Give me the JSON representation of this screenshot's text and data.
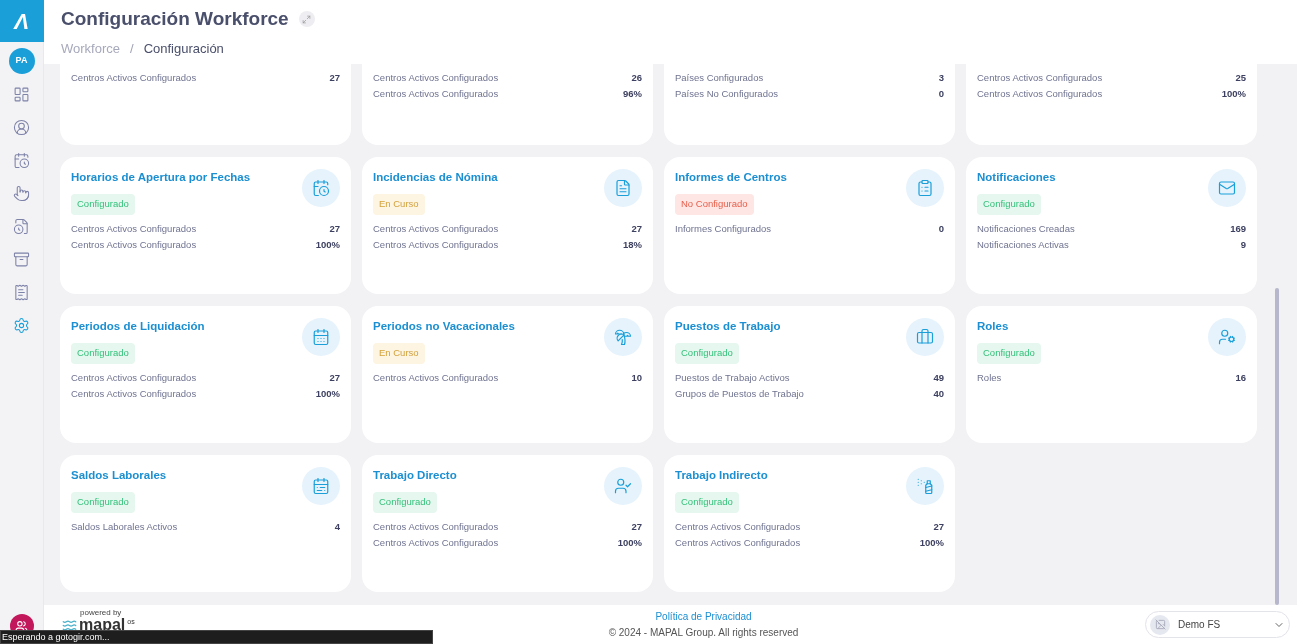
{
  "sidebar": {
    "logo": "Λ",
    "avatar": "PA",
    "items": [
      {
        "selected": false
      },
      {
        "selected": false
      },
      {
        "selected": false
      },
      {
        "selected": false
      },
      {
        "selected": false
      },
      {
        "selected": false
      },
      {
        "selected": false
      },
      {
        "selected": true
      }
    ]
  },
  "header": {
    "title": "Configuración Workforce",
    "breadcrumb": [
      {
        "label": "Workforce",
        "current": false
      },
      {
        "label": "Configuración",
        "current": true
      }
    ],
    "separator": "/"
  },
  "cards": [
    {
      "stats": [
        {
          "label": "Centros Activos Configurados",
          "value": "27"
        }
      ]
    },
    {
      "stats": [
        {
          "label": "Centros Activos Configurados",
          "value": "26"
        },
        {
          "label": "Centros Activos Configurados",
          "value": "96%"
        }
      ]
    },
    {
      "stats": [
        {
          "label": "Países Configurados",
          "value": "3"
        },
        {
          "label": "Países No Configurados",
          "value": "0"
        }
      ]
    },
    {
      "stats": [
        {
          "label": "Centros Activos Configurados",
          "value": "25"
        },
        {
          "label": "Centros Activos Configurados",
          "value": "100%"
        }
      ]
    },
    {
      "title": "Horarios de Apertura por Fechas",
      "kind": "configured",
      "badge": "Configurado",
      "stats": [
        {
          "label": "Centros Activos Configurados",
          "value": "27"
        },
        {
          "label": "Centros Activos Configurados",
          "value": "100%"
        }
      ]
    },
    {
      "title": "Incidencias de Nómina",
      "kind": "in_progress",
      "badge": "En Curso",
      "stats": [
        {
          "label": "Centros Activos Configurados",
          "value": "27"
        },
        {
          "label": "Centros Activos Configurados",
          "value": "18%"
        }
      ]
    },
    {
      "title": "Informes de Centros",
      "kind": "not_configured",
      "badge": "No Configurado",
      "stats": [
        {
          "label": "Informes Configurados",
          "value": "0"
        }
      ]
    },
    {
      "title": "Notificaciones",
      "kind": "configured",
      "badge": "Configurado",
      "stats": [
        {
          "label": "Notificaciones Creadas",
          "value": "169"
        },
        {
          "label": "Notificaciones Activas",
          "value": "9"
        }
      ]
    },
    {
      "title": "Periodos de Liquidación",
      "kind": "configured",
      "badge": "Configurado",
      "stats": [
        {
          "label": "Centros Activos Configurados",
          "value": "27"
        },
        {
          "label": "Centros Activos Configurados",
          "value": "100%"
        }
      ]
    },
    {
      "title": "Periodos no Vacacionales",
      "kind": "in_progress",
      "badge": "En Curso",
      "stats": [
        {
          "label": "Centros Activos Configurados",
          "value": "10"
        }
      ]
    },
    {
      "title": "Puestos de Trabajo",
      "kind": "configured",
      "badge": "Configurado",
      "stats": [
        {
          "label": "Puestos de Trabajo Activos",
          "value": "49"
        },
        {
          "label": "Grupos de Puestos de Trabajo",
          "value": "40"
        }
      ]
    },
    {
      "title": "Roles",
      "kind": "configured",
      "badge": "Configurado",
      "stats": [
        {
          "label": "Roles",
          "value": "16"
        }
      ]
    },
    {
      "title": "Saldos Laborales",
      "kind": "configured",
      "badge": "Configurado",
      "stats": [
        {
          "label": "Saldos Laborales Activos",
          "value": "4"
        }
      ]
    },
    {
      "title": "Trabajo Directo",
      "kind": "configured",
      "badge": "Configurado",
      "stats": [
        {
          "label": "Centros Activos Configurados",
          "value": "27"
        },
        {
          "label": "Centros Activos Configurados",
          "value": "100%"
        }
      ]
    },
    {
      "title": "Trabajo Indirecto",
      "kind": "configured",
      "badge": "Configurado",
      "stats": [
        {
          "label": "Centros Activos Configurados",
          "value": "27"
        },
        {
          "label": "Centros Activos Configurados",
          "value": "100%"
        }
      ]
    }
  ],
  "footer": {
    "powered_by": "powered by",
    "brand": "mapal",
    "brand_suffix": "os",
    "privacy_link": "Política de Privacidad",
    "copyright": "© 2024 - MAPAL Group. All rights reserved",
    "account": "Demo FS"
  },
  "status_overlay": "Esperando a gotogir.com..."
}
